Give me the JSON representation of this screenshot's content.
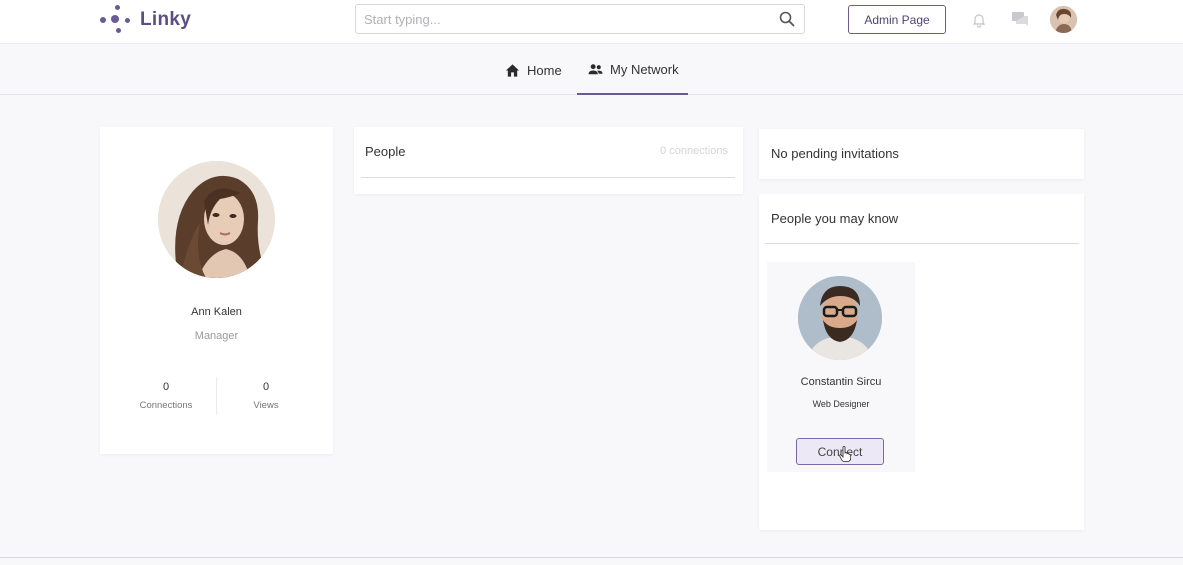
{
  "header": {
    "brand": "Linky",
    "search_placeholder": "Start typing...",
    "admin_label": "Admin Page"
  },
  "nav": {
    "home": "Home",
    "network": "My Network"
  },
  "profile": {
    "name": "Ann Kalen",
    "title": "Manager",
    "connections_count": "0",
    "connections_label": "Connections",
    "views_count": "0",
    "views_label": "Views"
  },
  "people": {
    "title": "People",
    "count": "0 connections"
  },
  "invitations": {
    "text": "No pending invitations"
  },
  "suggestions": {
    "title": "People you may know",
    "person": {
      "name": "Constantin Sircu",
      "role": "Web Designer",
      "connect_label": "Connect"
    }
  },
  "colors": {
    "accent": "#6a5b94",
    "background": "#f8f8fb"
  }
}
